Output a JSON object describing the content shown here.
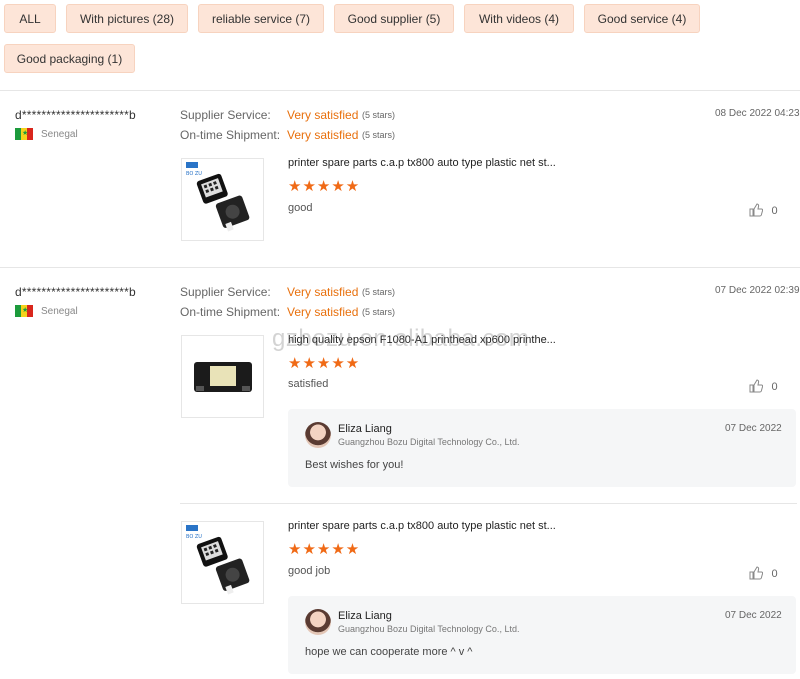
{
  "filters": [
    {
      "label": "ALL"
    },
    {
      "label": "With pictures (28)"
    },
    {
      "label": "reliable service (7)"
    },
    {
      "label": "Good supplier (5)"
    },
    {
      "label": "With videos (4)"
    },
    {
      "label": "Good service (4)"
    },
    {
      "label": "Good packaging (1)"
    }
  ],
  "labels": {
    "supplier_service": "Supplier Service:",
    "ontime_shipment": "On-time Shipment:"
  },
  "reviews": [
    {
      "user": "d**********************b",
      "country": "Senegal",
      "supplier_value": "Very satisfied",
      "supplier_stars": "(5 stars)",
      "shipment_value": "Very satisfied",
      "shipment_stars": "(5 stars)",
      "date": "08 Dec 2022 04:23",
      "items": [
        {
          "title": "printer spare parts c.a.p tx800 auto type plastic net st...",
          "stars": "★★★★★",
          "text": "good",
          "likes": "0"
        }
      ]
    },
    {
      "user": "d**********************b",
      "country": "Senegal",
      "supplier_value": "Very satisfied",
      "supplier_stars": "(5 stars)",
      "shipment_value": "Very satisfied",
      "shipment_stars": "(5 stars)",
      "date": "07 Dec 2022 02:39",
      "items": [
        {
          "title": "high quality epson F1080-A1 printhead xp600 printhe...",
          "stars": "★★★★★",
          "text": "satisfied",
          "likes": "0",
          "reply": {
            "name": "Eliza Liang",
            "company": "Guangzhou Bozu Digital Technology Co., Ltd.",
            "date": "07 Dec 2022",
            "message": "Best wishes for you!"
          }
        },
        {
          "title": "printer spare parts c.a.p tx800 auto type plastic net st...",
          "stars": "★★★★★",
          "text": "good job",
          "likes": "0",
          "reply": {
            "name": "Eliza Liang",
            "company": "Guangzhou Bozu Digital Technology Co., Ltd.",
            "date": "07 Dec 2022",
            "message": "hope we can cooperate more ^ v ^"
          }
        }
      ]
    }
  ],
  "watermark": "gzbozu.en.alibaba.com",
  "colors": {
    "accent": "#e8700d",
    "star": "#f06a16",
    "chip_bg": "#fde5d8"
  }
}
